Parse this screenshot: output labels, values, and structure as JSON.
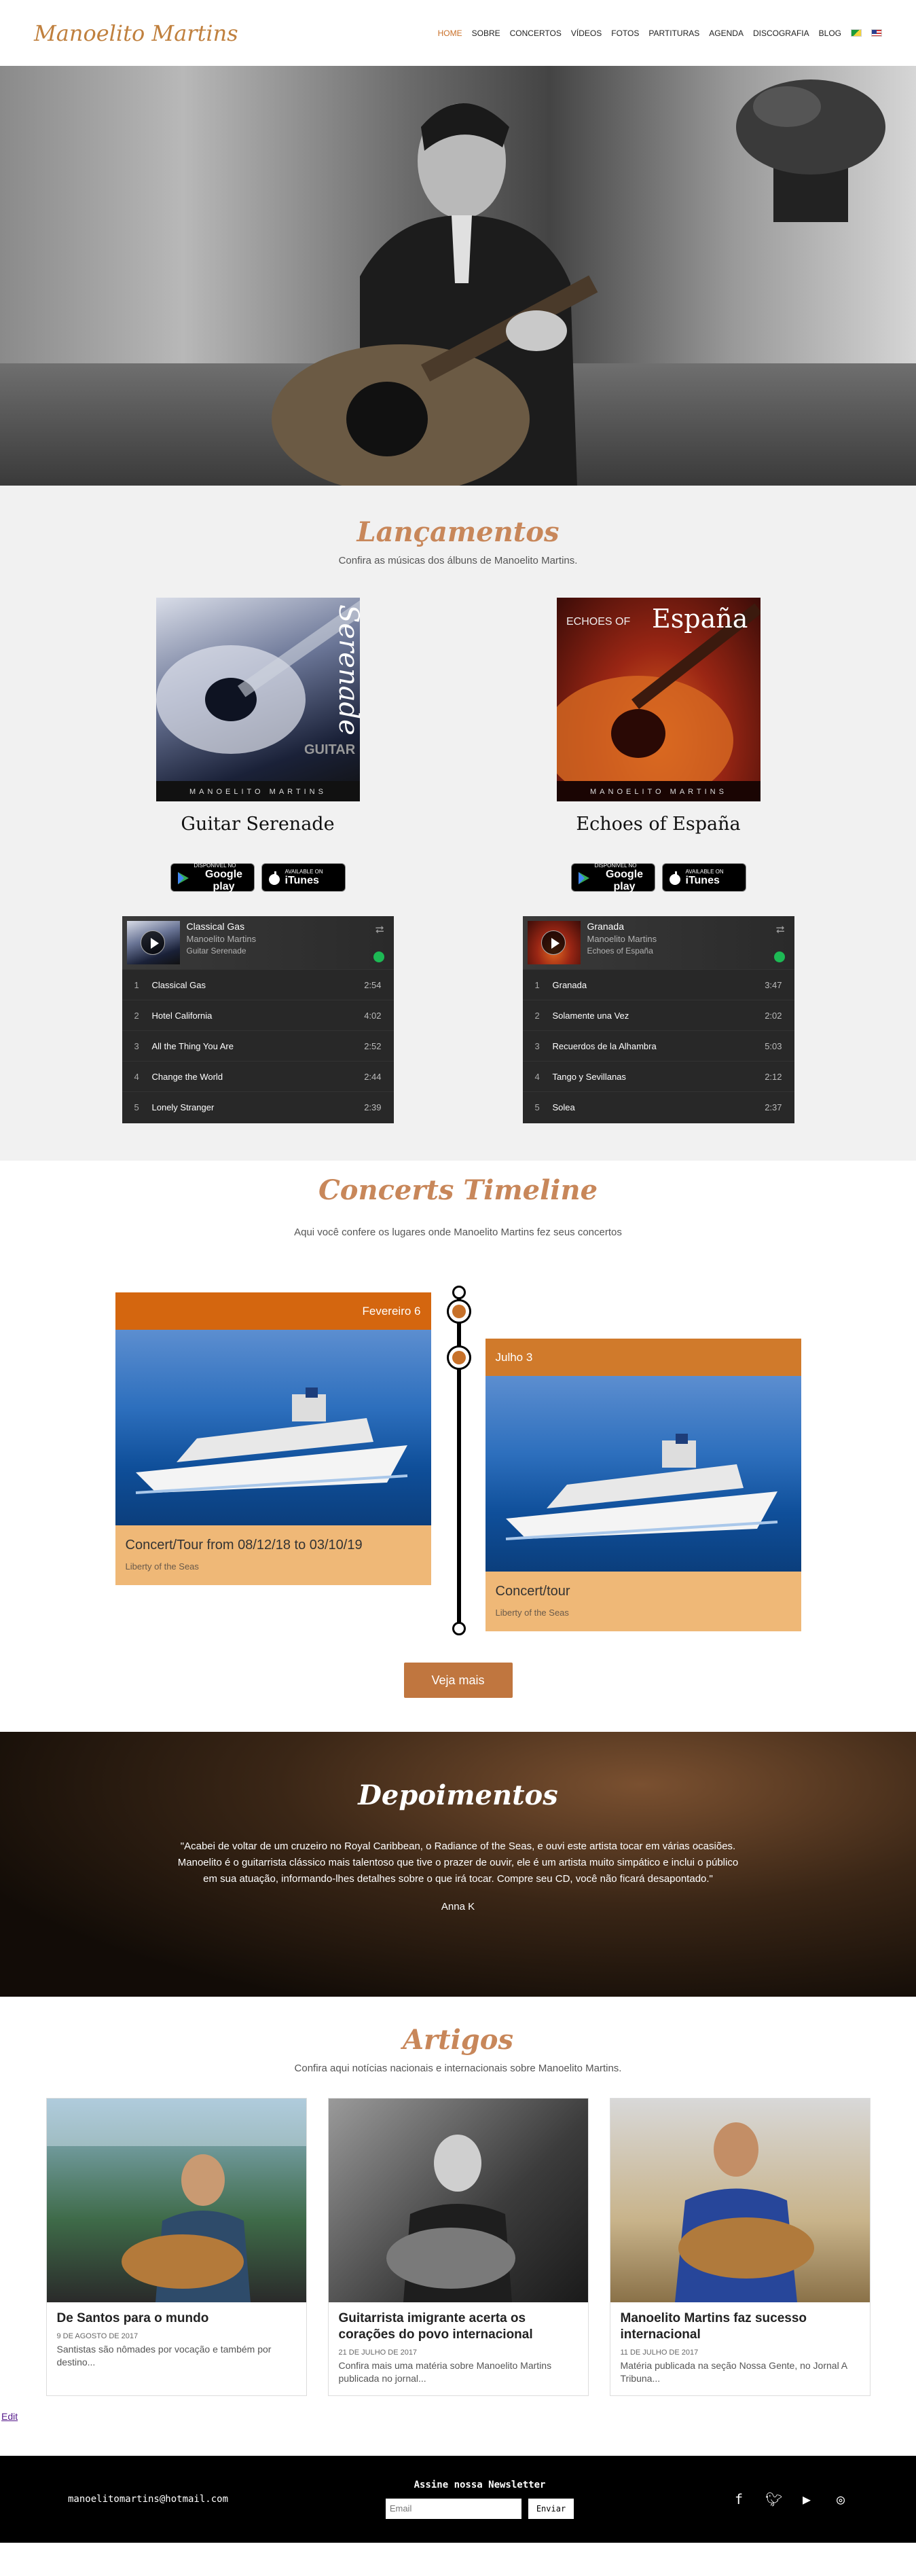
{
  "header": {
    "logo": "Manoelito Martins",
    "nav": [
      "HOME",
      "SOBRE",
      "CONCERTOS",
      "VÍDEOS",
      "FOTOS",
      "PARTITURAS",
      "AGENDA",
      "DISCOGRAFIA",
      "BLOG"
    ]
  },
  "releases": {
    "title": "Lançamentos",
    "subtitle": "Confira as músicas dos álbuns de Manoelito Martins.",
    "albums": [
      {
        "title": "Guitar Serenade",
        "cover_word_1": "Serenade",
        "cover_word_2": "GUITAR",
        "cover_artist": "MANOELITO MARTINS",
        "google_small": "DISPONÍVEL NO",
        "google_large": "Google play",
        "itunes_small": "Available on",
        "itunes_large": "iTunes",
        "player": {
          "track": "Classical Gas",
          "artist": "Manoelito Martins",
          "album": "Guitar Serenade",
          "tracks": [
            {
              "n": "1",
              "name": "Classical Gas",
              "dur": "2:54"
            },
            {
              "n": "2",
              "name": "Hotel California",
              "dur": "4:02"
            },
            {
              "n": "3",
              "name": "All the Thing You Are",
              "dur": "2:52"
            },
            {
              "n": "4",
              "name": "Change the World",
              "dur": "2:44"
            },
            {
              "n": "5",
              "name": "Lonely Stranger",
              "dur": "2:39"
            }
          ]
        }
      },
      {
        "title": "Echoes of España",
        "cover_word_1": "ECHOES OF",
        "cover_word_2": "España",
        "cover_artist": "MANOELITO MARTINS",
        "google_small": "DISPONÍVEL NO",
        "google_large": "Google play",
        "itunes_small": "Available on",
        "itunes_large": "iTunes",
        "player": {
          "track": "Granada",
          "artist": "Manoelito Martins",
          "album": "Echoes of España",
          "tracks": [
            {
              "n": "1",
              "name": "Granada",
              "dur": "3:47"
            },
            {
              "n": "2",
              "name": "Solamente una Vez",
              "dur": "2:02"
            },
            {
              "n": "3",
              "name": "Recuerdos de la Alhambra",
              "dur": "5:03"
            },
            {
              "n": "4",
              "name": "Tango y Sevillanas",
              "dur": "2:12"
            },
            {
              "n": "5",
              "name": "Solea",
              "dur": "2:37"
            }
          ]
        }
      }
    ]
  },
  "timeline": {
    "title": "Concerts Timeline",
    "subtitle": "Aqui você confere os lugares onde Manoelito Martins fez seus concertos",
    "events": [
      {
        "date": "Fevereiro 6",
        "title": "Concert/Tour from 08/12/18 to 03/10/19",
        "location": "Liberty of the Seas"
      },
      {
        "date": "Julho 3",
        "title": "Concert/tour",
        "location": "Liberty of the Seas"
      }
    ],
    "more_button": "Veja mais"
  },
  "testimonials": {
    "title": "Depoimentos",
    "quote": "\"Acabei de voltar de um cruzeiro no Royal Caribbean, o Radiance of the Seas, e ouvi este artista tocar em várias ocasiões. Manoelito é o guitarrista clássico mais talentoso que tive o prazer de ouvir, ele é um artista muito simpático e inclui o público em sua atuação, informando-lhes detalhes sobre o que irá tocar. Compre seu CD, você não ficará desapontado.\"",
    "author": "Anna K"
  },
  "articles": {
    "title": "Artigos",
    "subtitle": "Confira aqui notícias nacionais e internacionais sobre Manoelito Martins.",
    "cards": [
      {
        "title": "De Santos para o mundo",
        "date": "9 DE AGOSTO DE 2017",
        "text": " Santistas são nômades por vocação e também por destino..."
      },
      {
        "title": "Guitarrista imigrante acerta os corações do povo internacional",
        "date": "21 DE JULHO DE 2017",
        "text": "Confira mais uma matéria sobre Manoelito Martins publicada no jornal..."
      },
      {
        "title": "Manoelito Martins faz sucesso internacional",
        "date": "11 DE JULHO DE 2017",
        "text": "Matéria publicada na seção Nossa Gente, no Jornal A Tribuna..."
      }
    ],
    "edit_link": "Edit"
  },
  "footer": {
    "email": "manoelitomartins@hotmail.com",
    "newsletter_title": "Assine nossa Newsletter",
    "newsletter_placeholder": "Email",
    "newsletter_button": "Enviar",
    "social_icons": [
      "facebook-icon",
      "twitter-icon",
      "youtube-icon",
      "instagram-icon"
    ]
  },
  "colors": {
    "accent": "#c8875a",
    "nav_active": "#c96f28",
    "timeline_header": "#d4660f",
    "timeline_card": "#efb877",
    "button": "#c0763f"
  }
}
